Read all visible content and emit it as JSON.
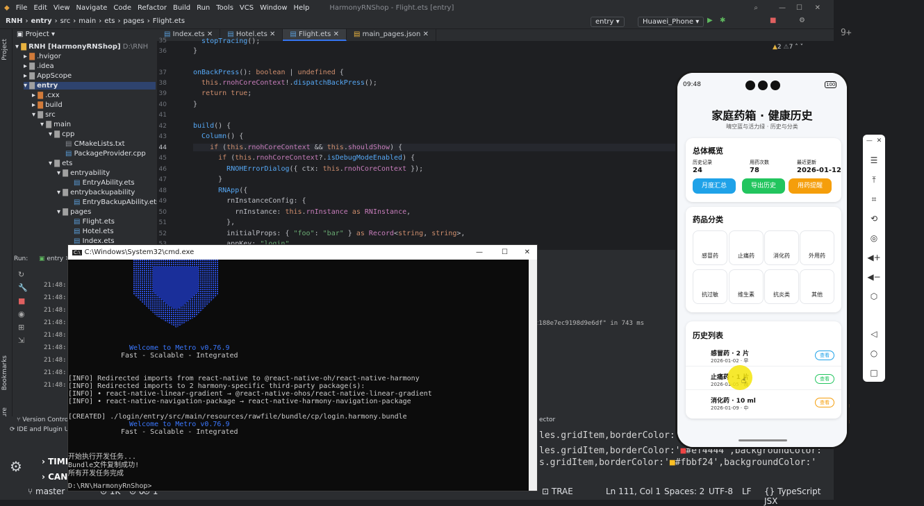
{
  "ide": {
    "menu": [
      "File",
      "Edit",
      "View",
      "Navigate",
      "Code",
      "Refactor",
      "Build",
      "Run",
      "Tools",
      "VCS",
      "Window",
      "Help"
    ],
    "window_title": "HarmonyRNShop - Flight.ets [entry]",
    "breadcrumb": [
      "RNH",
      "entry",
      "src",
      "main",
      "ets",
      "pages",
      "Flight.ets"
    ],
    "run_config": "entry",
    "device": "Huawei_Phone",
    "project_label": "Project",
    "tabs": [
      "Index.ets",
      "Hotel.ets",
      "Flight.ets",
      "main_pages.json"
    ],
    "inspections": {
      "warnings": "2",
      "weak": "7"
    },
    "tree": [
      {
        "label": "RNH [HarmonyRNShop]",
        "extra": "D:\\RNH",
        "indent": 0
      },
      {
        "label": ".hvigor",
        "indent": 1
      },
      {
        "label": ".idea",
        "indent": 1
      },
      {
        "label": "AppScope",
        "indent": 1
      },
      {
        "label": "entry",
        "indent": 1
      },
      {
        "label": ".cxx",
        "indent": 2
      },
      {
        "label": "build",
        "indent": 2
      },
      {
        "label": "src",
        "indent": 2
      },
      {
        "label": "main",
        "indent": 3
      },
      {
        "label": "cpp",
        "indent": 4
      },
      {
        "label": "CMakeLists.txt",
        "indent": 5
      },
      {
        "label": "PackageProvider.cpp",
        "indent": 5
      },
      {
        "label": "ets",
        "indent": 4
      },
      {
        "label": "entryability",
        "indent": 5
      },
      {
        "label": "EntryAbility.ets",
        "indent": 6
      },
      {
        "label": "entrybackupability",
        "indent": 5
      },
      {
        "label": "EntryBackupAbility.ets",
        "indent": 6
      },
      {
        "label": "pages",
        "indent": 5
      },
      {
        "label": "Flight.ets",
        "indent": 6
      },
      {
        "label": "Hotel.ets",
        "indent": 6
      },
      {
        "label": "Index.ets",
        "indent": 6
      }
    ],
    "line_numbers": [
      "35",
      "36",
      "37",
      "38",
      "39",
      "40",
      "41",
      "42",
      "43",
      "44",
      "45",
      "46",
      "47",
      "48",
      "49",
      "50",
      "51",
      "52",
      "53"
    ],
    "run_label": "Run:",
    "run_tab": "entry",
    "run_times": [
      "21:48:",
      "21:48:",
      "21:48:",
      "21:48:",
      "21:48:",
      "21:48:",
      "21:48:",
      "21:48:",
      "21:48:",
      "21:48:"
    ],
    "run_message": "c188e7ec9198d9e6df\" in 743 ms",
    "side_labels": [
      "Project",
      "Bookmarks",
      "Structure"
    ],
    "right_side_label": "AppAnalyzer",
    "bottom_tabs": [
      "Version Control",
      "IDE and Plugin Up"
    ],
    "bottom_extra": [
      "TIMEL",
      "CANGE"
    ],
    "detector_label": "ector",
    "status": {
      "branch": "master",
      "count1": "1K",
      "count2": "0",
      "count3": "1",
      "trae": "TRAE",
      "position": "Ln 111, Col 1",
      "spaces": "Spaces: 2",
      "encoding": "UTF-8",
      "eol": "LF",
      "lang": "TypeScript JSX"
    },
    "bg_code": [
      "les.gridItem,borderColor:'",
      "les.gridItem,borderColor:'",
      "s.gridItem,borderColor:'"
    ],
    "bg_code_tail": [
      "#ef4444',backgroundColor:'",
      "#fbbf24',backgroundColor:'"
    ],
    "bg_code_tail2": [
      "#fee",
      "#fffbe"
    ]
  },
  "cmd": {
    "title": "C:\\Windows\\System32\\cmd.exe",
    "welcome1": "Welcome to Metro v0.76.9",
    "tagline1": "Fast - Scalable - Integrated",
    "info": [
      "[INFO] Redirected imports from react-native to @react-native-oh/react-native-harmony",
      "[INFO] Redirected imports to 2 harmony-specific third-party package(s):",
      "[INFO] • react-native-linear-gradient → @react-native-ohos/react-native-linear-gradient",
      "[INFO] • react-native-navigation-package → react-native-harmony-navigation-package"
    ],
    "created": "[CREATED] ./login/entry/src/main/resources/rawfile/bundle/cp/login.harmony.bundle",
    "welcome2": "Welcome to Metro v0.76.9",
    "tagline2": "Fast - Scalable - Integrated",
    "tasks": [
      "开始执行开发任务...",
      "Bundle文件复制成功!",
      "所有开发任务完成"
    ],
    "prompt": "D:\\RN\\HarmonyRnShop>"
  },
  "phone": {
    "time": "09:48",
    "battery": "100",
    "title": "家庭药箱 · 健康历史",
    "subtitle": "晴空蓝与活力绿 · 历史与分类",
    "overview": {
      "heading": "总体概览",
      "stats": [
        {
          "label": "历史记录",
          "value": "24"
        },
        {
          "label": "用药次数",
          "value": "78"
        },
        {
          "label": "最近更新",
          "value": "2026-01-12"
        }
      ],
      "buttons": [
        {
          "label": "月度汇总",
          "color": "#1fa2e8"
        },
        {
          "label": "导出历史",
          "color": "#22c55e"
        },
        {
          "label": "用药提醒",
          "color": "#f59e0b"
        }
      ]
    },
    "categories": {
      "heading": "药品分类",
      "items": [
        "感冒药",
        "止痛药",
        "消化药",
        "外用药",
        "抗过敏",
        "维生素",
        "抗炎类",
        "其他"
      ]
    },
    "history": {
      "heading": "历史列表",
      "items": [
        {
          "name": "感冒药 · 2 片",
          "meta": "2026-01-02 · 早",
          "action": "查看",
          "color": "#1fa2e8"
        },
        {
          "name": "止痛药 · 1 片",
          "meta": "2026-01-05 · 晚",
          "action": "查看",
          "color": "#22c55e"
        },
        {
          "name": "消化药 · 10 ml",
          "meta": "2026-01-09 · 中",
          "action": "查看",
          "color": "#f59e0b"
        }
      ]
    }
  },
  "colors": {
    "accent": "#3574f0",
    "cursor_highlight": "#f5e50a"
  }
}
